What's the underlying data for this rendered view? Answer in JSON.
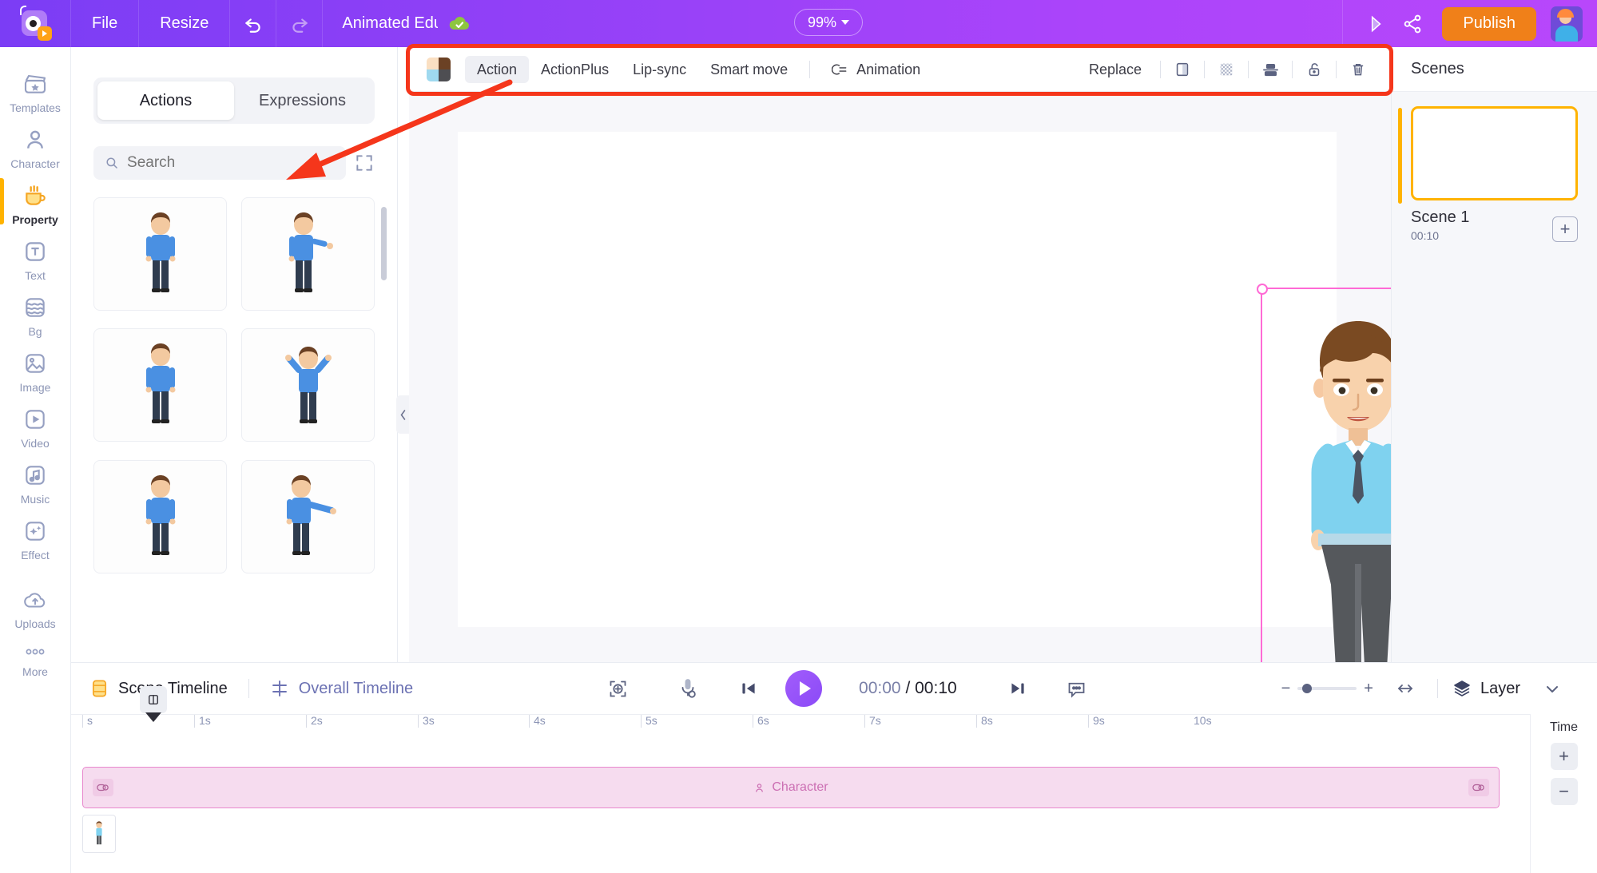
{
  "app": {
    "logo": "animaker-logo",
    "menus": [
      {
        "label": "File",
        "name": "menu-file"
      },
      {
        "label": "Resize",
        "name": "menu-resize"
      }
    ],
    "undo_icon": "undo-icon",
    "redo_icon": "redo-icon",
    "project_title": "Animated Educa",
    "cloud_status_icon": "cloud-saved-icon",
    "zoom_level": "99%",
    "preview_icon": "preview-play-icon",
    "share_icon": "share-icon",
    "publish_label": "Publish",
    "avatar_icon": "user-avatar"
  },
  "sidebar": {
    "items": [
      {
        "label": "Templates",
        "icon": "clapperboard-icon",
        "active": false
      },
      {
        "label": "Character",
        "icon": "person-icon",
        "active": false
      },
      {
        "label": "Property",
        "icon": "coffee-cup-icon",
        "active": true
      },
      {
        "label": "Text",
        "icon": "text-t-icon",
        "active": false
      },
      {
        "label": "Bg",
        "icon": "background-layers-icon",
        "active": false
      },
      {
        "label": "Image",
        "icon": "image-icon",
        "active": false
      },
      {
        "label": "Video",
        "icon": "video-play-icon",
        "active": false
      },
      {
        "label": "Music",
        "icon": "music-note-icon",
        "active": false
      },
      {
        "label": "Effect",
        "icon": "sparkle-effect-icon",
        "active": false
      },
      {
        "label": "Uploads",
        "icon": "cloud-upload-icon",
        "active": false
      },
      {
        "label": "More",
        "icon": "more-dots-icon",
        "active": false
      }
    ]
  },
  "panel": {
    "tabs": [
      {
        "label": "Actions",
        "active": true
      },
      {
        "label": "Expressions",
        "active": false
      }
    ],
    "search": {
      "placeholder": "Search",
      "value": "",
      "icon": "search-icon"
    },
    "expand_icon": "expand-fullscreen-icon",
    "collapse_icon": "chevron-left-icon",
    "thumbnails": [
      {
        "name": "action-thumb-1",
        "pose": "standing-idle"
      },
      {
        "name": "action-thumb-2",
        "pose": "pointing-right"
      },
      {
        "name": "action-thumb-3",
        "pose": "standing-idle-2"
      },
      {
        "name": "action-thumb-4",
        "pose": "hands-on-head"
      },
      {
        "name": "action-thumb-5",
        "pose": "standing-idle-3"
      },
      {
        "name": "action-thumb-6",
        "pose": "presenting-right"
      }
    ]
  },
  "edit_toolbar": {
    "swatch_colors": [
      "#fadfc2",
      "#6b4124",
      "#9fd9ef",
      "#4e4e52"
    ],
    "items": [
      {
        "label": "Action",
        "active": true
      },
      {
        "label": "ActionPlus",
        "active": false
      },
      {
        "label": "Lip-sync",
        "active": false
      },
      {
        "label": "Smart move",
        "active": false
      }
    ],
    "animation_label": "Animation",
    "animation_icon": "animation-swirl-icon",
    "replace_label": "Replace",
    "right_icons": [
      {
        "name": "flip-icon"
      },
      {
        "name": "transparency-checker-icon"
      },
      {
        "name": "align-icon"
      },
      {
        "name": "unlock-icon"
      },
      {
        "name": "delete-trash-icon"
      }
    ]
  },
  "canvas": {
    "selection": {
      "handles": [
        "top-left",
        "top-right",
        "bottom-left",
        "bottom-right"
      ],
      "play_icon": "play-preview-icon",
      "rotate_icon": "rotate-handle-icon"
    },
    "character": "business-man-blue-shirt"
  },
  "scenes": {
    "title": "Scenes",
    "list": [
      {
        "name": "Scene 1",
        "duration": "00:10",
        "active": true
      }
    ],
    "add_label": "+"
  },
  "timeline": {
    "scene_tab": {
      "label": "Scene Timeline",
      "icon": "scene-timeline-icon",
      "active": true
    },
    "overall_tab": {
      "label": "Overall Timeline",
      "icon": "overall-timeline-icon",
      "active": false
    },
    "controls": {
      "fit_icon": "fit-to-screen-icon",
      "mic_icon": "microphone-record-icon",
      "prev_icon": "skip-to-start-icon",
      "play_icon": "play-icon",
      "next_icon": "skip-to-end-icon",
      "subtitle_icon": "subtitle-icon",
      "current_time": "00:00",
      "separator": "/",
      "total_time": "00:10",
      "zoom_out": "−",
      "zoom_in": "+",
      "fit_width_icon": "fit-width-icon",
      "layer_label": "Layer",
      "layer_icon": "layers-icon",
      "collapse_icon": "chevron-down-icon"
    },
    "ruler_ticks": [
      "s",
      "1s",
      "2s",
      "3s",
      "4s",
      "5s",
      "6s",
      "7s",
      "8s",
      "9s",
      "10s"
    ],
    "track": {
      "label": "Character",
      "icon": "character-track-icon",
      "cap_icon": "keyframe-toggle-icon"
    },
    "time_column": {
      "header": "Time",
      "add": "+",
      "minus": "−"
    }
  }
}
